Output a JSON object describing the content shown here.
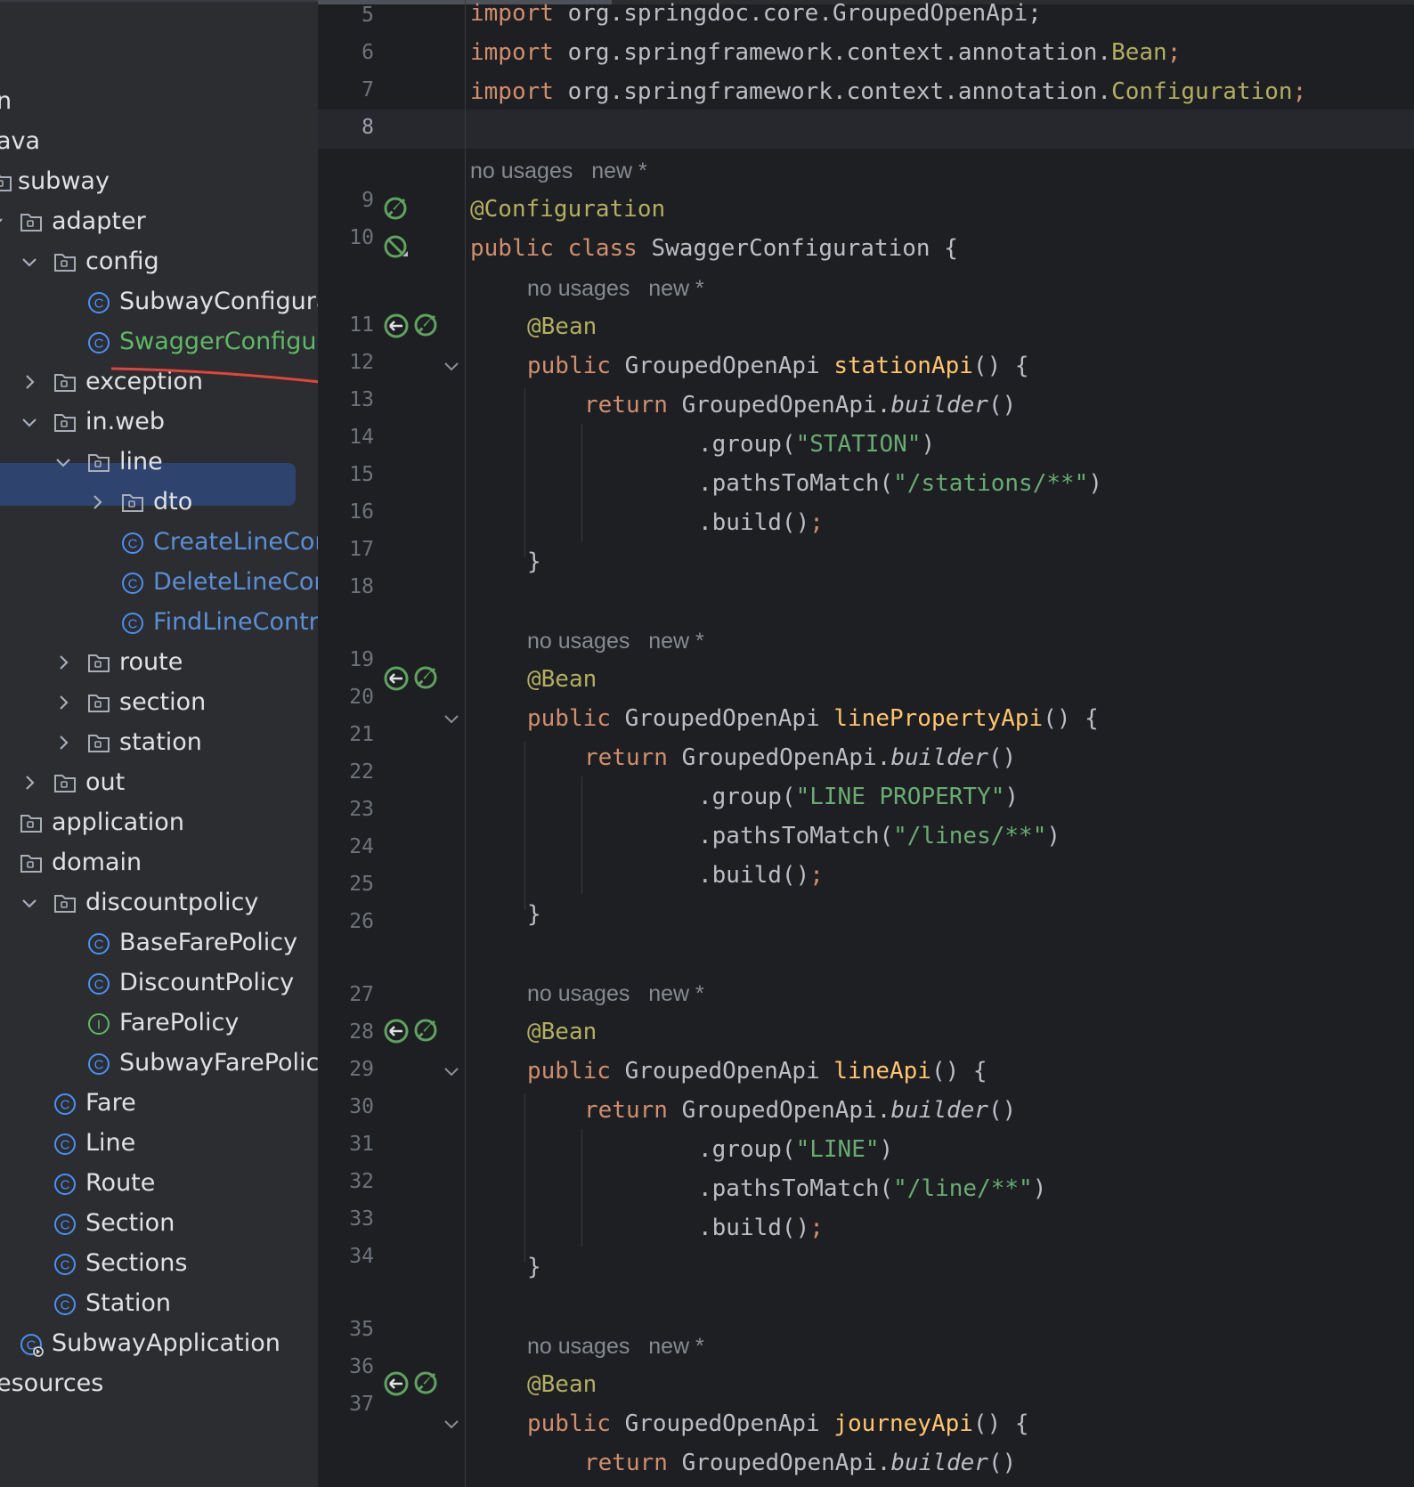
{
  "project_tree": {
    "items": [
      {
        "label": "n",
        "chevron": "",
        "icon": "",
        "color": "default"
      },
      {
        "label": "ava",
        "chevron": "",
        "icon": "",
        "color": "default"
      },
      {
        "label": "subway",
        "chevron": "",
        "icon": "package",
        "color": "default"
      },
      {
        "label": "adapter",
        "chevron": "down",
        "icon": "package",
        "color": "default"
      },
      {
        "label": "config",
        "chevron": "down",
        "icon": "package",
        "color": "default"
      },
      {
        "label": "SubwayConfigura",
        "chevron": "",
        "icon": "class",
        "color": "default"
      },
      {
        "label": "SwaggerConfigura",
        "chevron": "",
        "icon": "class",
        "color": "green"
      },
      {
        "label": "exception",
        "chevron": "right",
        "icon": "package",
        "color": "default"
      },
      {
        "label": "in.web",
        "chevron": "down",
        "icon": "package",
        "color": "default"
      },
      {
        "label": "line",
        "chevron": "down",
        "icon": "package",
        "color": "default"
      },
      {
        "label": "dto",
        "chevron": "right",
        "icon": "package",
        "color": "default"
      },
      {
        "label": "CreateLineCon",
        "chevron": "",
        "icon": "class",
        "color": "blue"
      },
      {
        "label": "DeleteLineCon",
        "chevron": "",
        "icon": "class",
        "color": "blue"
      },
      {
        "label": "FindLineContro",
        "chevron": "",
        "icon": "class",
        "color": "blue"
      },
      {
        "label": "route",
        "chevron": "right",
        "icon": "package",
        "color": "default"
      },
      {
        "label": "section",
        "chevron": "right",
        "icon": "package",
        "color": "default"
      },
      {
        "label": "station",
        "chevron": "right",
        "icon": "package",
        "color": "default"
      },
      {
        "label": "out",
        "chevron": "right",
        "icon": "package",
        "color": "default"
      },
      {
        "label": "application",
        "chevron": "",
        "icon": "package",
        "color": "default"
      },
      {
        "label": "domain",
        "chevron": "",
        "icon": "package",
        "color": "default"
      },
      {
        "label": "discountpolicy",
        "chevron": "down",
        "icon": "package",
        "color": "default"
      },
      {
        "label": "BaseFarePolicy",
        "chevron": "",
        "icon": "class",
        "color": "default"
      },
      {
        "label": "DiscountPolicy",
        "chevron": "",
        "icon": "class",
        "color": "default"
      },
      {
        "label": "FarePolicy",
        "chevron": "",
        "icon": "interface",
        "color": "default"
      },
      {
        "label": "SubwayFarePolicy",
        "chevron": "",
        "icon": "class",
        "color": "default"
      },
      {
        "label": "Fare",
        "chevron": "",
        "icon": "class",
        "color": "default"
      },
      {
        "label": "Line",
        "chevron": "",
        "icon": "class",
        "color": "default"
      },
      {
        "label": "Route",
        "chevron": "",
        "icon": "class",
        "color": "default"
      },
      {
        "label": "Section",
        "chevron": "",
        "icon": "class",
        "color": "default"
      },
      {
        "label": "Sections",
        "chevron": "",
        "icon": "class",
        "color": "default"
      },
      {
        "label": "Station",
        "chevron": "",
        "icon": "class",
        "color": "default"
      },
      {
        "label": "SubwayApplication",
        "chevron": "",
        "icon": "app-class",
        "color": "default"
      },
      {
        "label": "esources",
        "chevron": "",
        "icon": "",
        "color": "default"
      }
    ],
    "selected_item": "line"
  },
  "editor": {
    "line_numbers": [
      "5",
      "6",
      "7",
      "8",
      "9",
      "10",
      "11",
      "12",
      "13",
      "14",
      "15",
      "16",
      "17",
      "18",
      "19",
      "20",
      "21",
      "22",
      "23",
      "24",
      "25",
      "26",
      "27",
      "28",
      "29",
      "30",
      "31",
      "32",
      "33",
      "34",
      "35",
      "36",
      "37"
    ],
    "current_line": "8",
    "hints": {
      "usages": "no usages",
      "author": "new *"
    },
    "code": {
      "l5_kw": "import",
      "l5_rest": " org.springdoc.core.GroupedOpenApi;",
      "l6_kw": "import",
      "l6_pkg": " org.springframework.context.annotation.",
      "l6_cls": "Bean",
      "l6_semi": ";",
      "l7_kw": "import",
      "l7_pkg": " org.springframework.context.annotation.",
      "l7_cls": "Configuration",
      "l7_semi": ";",
      "l9": "@Configuration",
      "l10_kw": "public class",
      "l10_rest": " SwaggerConfiguration {",
      "bean": "@Bean",
      "pub": "public",
      "type": " GroupedOpenApi ",
      "m1": "stationApi",
      "m2": "linePropertyApi",
      "m3": "lineApi",
      "m4": "journeyApi",
      "sig_tail": "() {",
      "ret": "return",
      "builder_pre": " GroupedOpenApi.",
      "builder": "builder",
      "builder_post": "()",
      "group_pre": ".group(",
      "g1": "\"STATION\"",
      "g2": "\"LINE PROPERTY\"",
      "g3": "\"LINE\"",
      "paths_pre": ".pathsToMatch(",
      "p1": "\"/stations/**\"",
      "p2": "\"/lines/**\"",
      "p3": "\"/line/**\"",
      "close_paren": ")",
      "build": ".build()",
      "semi": ";",
      "rbrace": "}"
    }
  },
  "colors": {
    "keyword": "#cf8e6d",
    "annotation": "#b3ae60",
    "string": "#6aab73",
    "method": "#ffc66d",
    "selection": "#2e436e",
    "underline": "#e0443a"
  }
}
